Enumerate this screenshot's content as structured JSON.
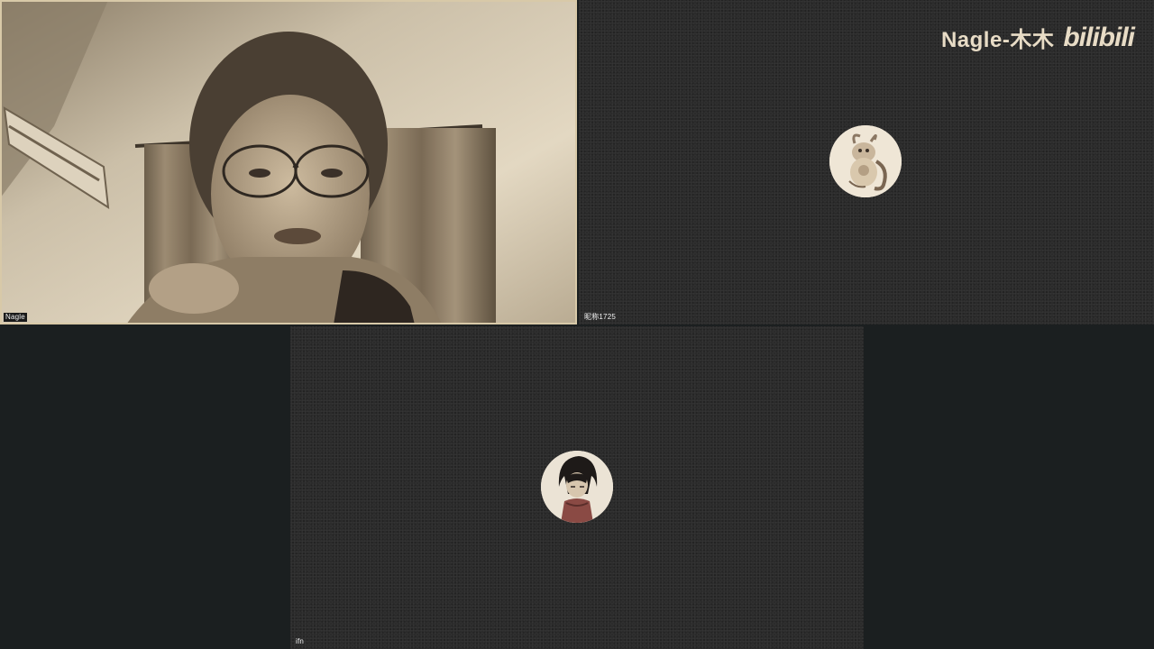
{
  "participants": [
    {
      "name": "Nagle"
    },
    {
      "name": "昵称1725"
    },
    {
      "name": "ifn"
    }
  ],
  "watermark": {
    "text": "Nagle-木木",
    "logo_text": "bilibili"
  },
  "colors": {
    "background": "#1b1f20",
    "tile_dark": "#2b2b2b",
    "tile_border": "#d8c9a8",
    "label_text": "#f2f2f2"
  },
  "icons": {
    "avatar_2": "cartoon-animal-avatar",
    "avatar_3": "anime-character-avatar"
  }
}
